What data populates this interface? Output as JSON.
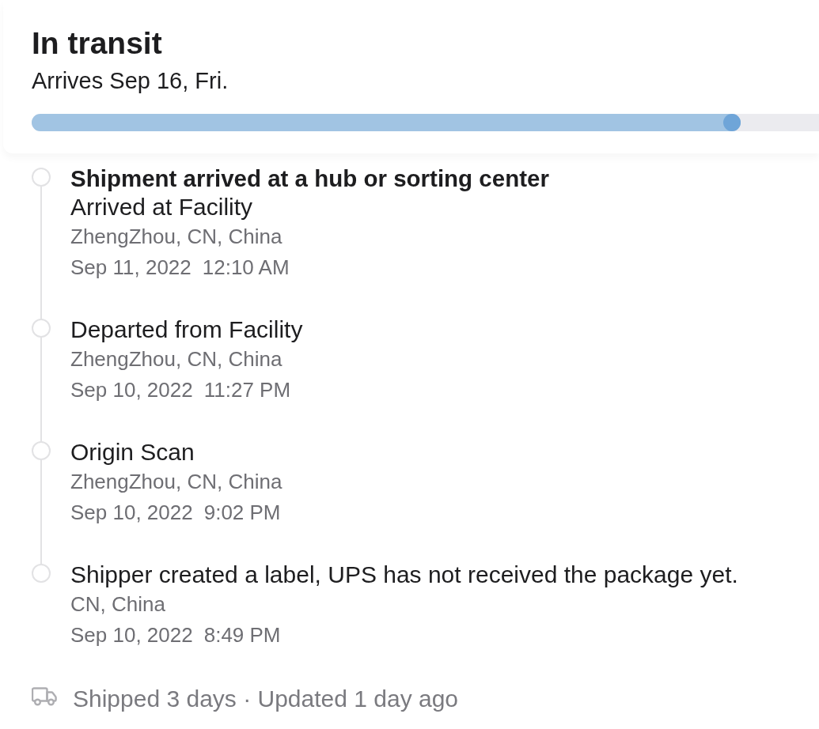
{
  "header": {
    "title": "In transit",
    "subtitle": "Arrives Sep 16, Fri.",
    "progress": {
      "level": 0.9
    }
  },
  "events": [
    {
      "heading": "Shipment arrived at a hub or sorting center",
      "status": "Arrived at Facility",
      "location": "ZhengZhou, CN, China",
      "date": "Sep 11, 2022",
      "time": "12:10 AM"
    },
    {
      "status": "Departed from Facility",
      "location": "ZhengZhou, CN, China",
      "date": "Sep 10, 2022",
      "time": "11:27 PM"
    },
    {
      "status": "Origin Scan",
      "location": "ZhengZhou, CN, China",
      "date": "Sep 10, 2022",
      "time": "9:02 PM"
    },
    {
      "status": "Shipper created a label, UPS has not received the package yet.",
      "location": "CN, China",
      "date": "Sep 10, 2022",
      "time": "8:49 PM"
    }
  ],
  "footer": {
    "text": "Shipped 3 days · Updated 1 day ago"
  }
}
